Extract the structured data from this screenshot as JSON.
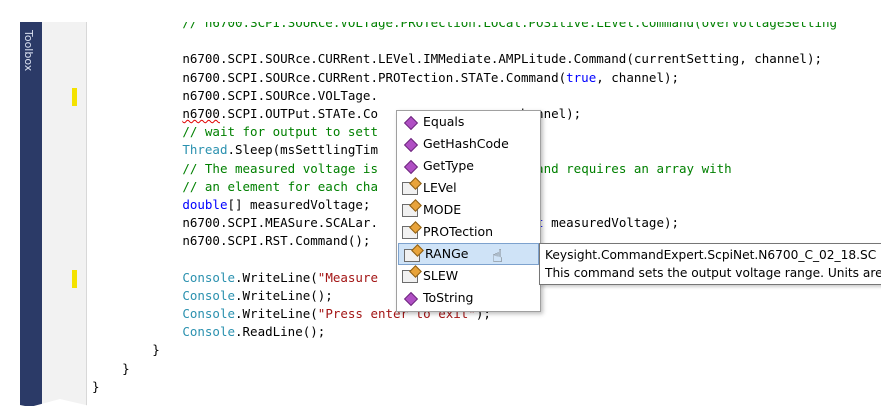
{
  "toolbox": {
    "label": "Toolbox"
  },
  "code_lines": [
    {
      "segments": [
        {
          "cls": "cm",
          "text": "// n6700.SCPI.SOURce.VOLTage.PROTection.LOCal.POSitive.LEVel.Command(overVoltageSetting"
        }
      ]
    },
    {
      "segments": []
    },
    {
      "segments": [
        {
          "cls": "",
          "text": "n6700.SCPI.SOURce.CURRent.LEVel.IMMediate.AMPLitude.Command(currentSetting, channel);"
        }
      ]
    },
    {
      "segments": [
        {
          "cls": "",
          "text": "n6700.SCPI.SOURce.CURRent.PROTection.STATe.Command("
        },
        {
          "cls": "kw",
          "text": "true"
        },
        {
          "cls": "",
          "text": ", channel);"
        }
      ]
    },
    {
      "segments": [
        {
          "cls": "",
          "text": "n6700.SCPI.SOURce.VOLTage."
        }
      ]
    },
    {
      "segments": [
        {
          "cls": "squig",
          "text": "n6700"
        },
        {
          "cls": "",
          "text": ".SCPI.OUTPut.STATe.Co"
        },
        {
          "cls": "pad",
          "text": "                  "
        },
        {
          "cls": "",
          "text": "channel);"
        }
      ]
    },
    {
      "segments": [
        {
          "cls": "cm",
          "text": "// wait for output to sett"
        }
      ]
    },
    {
      "segments": [
        {
          "cls": "ty",
          "text": "Thread"
        },
        {
          "cls": "",
          "text": ".Sleep(msSettlingTim"
        }
      ]
    },
    {
      "segments": [
        {
          "cls": "cm",
          "text": "// The measured voltage is"
        },
        {
          "cls": "pad",
          "text": "           "
        },
        {
          "cls": "cm",
          "text": "parameter and requires an array with"
        }
      ]
    },
    {
      "segments": [
        {
          "cls": "cm",
          "text": "// an element for each cha"
        }
      ]
    },
    {
      "segments": [
        {
          "cls": "kw",
          "text": "double"
        },
        {
          "cls": "",
          "text": "[] measuredVoltage;"
        }
      ]
    },
    {
      "segments": [
        {
          "cls": "",
          "text": "n6700.SCPI.MEASure.SCALar."
        },
        {
          "cls": "pad",
          "text": "           "
        },
        {
          "cls": "",
          "text": "hannel, "
        },
        {
          "cls": "kw",
          "text": "out"
        },
        {
          "cls": "",
          "text": " measuredVoltage);"
        }
      ]
    },
    {
      "segments": [
        {
          "cls": "",
          "text": "n6700.SCPI.RST.Command();"
        }
      ]
    },
    {
      "segments": []
    },
    {
      "segments": [
        {
          "cls": "ty",
          "text": "Console"
        },
        {
          "cls": "",
          "text": ".WriteLine("
        },
        {
          "cls": "str",
          "text": "\"Measure"
        }
      ]
    },
    {
      "segments": [
        {
          "cls": "ty",
          "text": "Console"
        },
        {
          "cls": "",
          "text": ".WriteLine();"
        }
      ]
    },
    {
      "segments": [
        {
          "cls": "ty",
          "text": "Console"
        },
        {
          "cls": "",
          "text": ".WriteLine("
        },
        {
          "cls": "str",
          "text": "\"Press enter to exit\""
        },
        {
          "cls": "",
          "text": ");"
        }
      ]
    },
    {
      "segments": [
        {
          "cls": "ty",
          "text": "Console"
        },
        {
          "cls": "",
          "text": ".ReadLine();"
        }
      ]
    }
  ],
  "braces": [
    "}",
    "}",
    "}"
  ],
  "intellisense": {
    "items": [
      {
        "label": "Equals",
        "icon": "method-icon",
        "selected": false
      },
      {
        "label": "GetHashCode",
        "icon": "method-icon",
        "selected": false
      },
      {
        "label": "GetType",
        "icon": "method-icon",
        "selected": false
      },
      {
        "label": "LEVel",
        "icon": "property-icon",
        "selected": false
      },
      {
        "label": "MODE",
        "icon": "property-icon",
        "selected": false
      },
      {
        "label": "PROTection",
        "icon": "property-icon",
        "selected": false
      },
      {
        "label": "RANGe",
        "icon": "property-icon",
        "selected": true
      },
      {
        "label": "SLEW",
        "icon": "property-icon",
        "selected": false
      },
      {
        "label": "ToString",
        "icon": "method-icon",
        "selected": false
      }
    ]
  },
  "tooltip": {
    "line1": "Keysight.CommandExpert.ScpiNet.N6700_C_02_18.SC",
    "line2": "This command sets the output voltage range. Units are"
  },
  "colors": {
    "comment": "#008000",
    "keyword": "#0000ff",
    "type": "#2b91af",
    "string": "#a31515",
    "toolbox": "#2b3a67",
    "selection": "#cfe3f7"
  }
}
